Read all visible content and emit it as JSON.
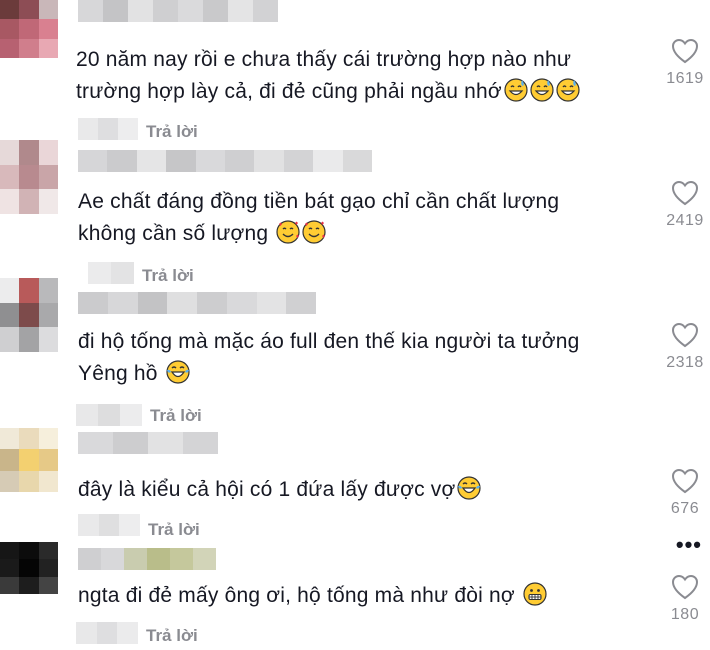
{
  "comments": [
    {
      "text_line1": "20 năm nay rồi e chưa thấy cái trường hợp nào như",
      "text_line2": "trường hợp lày cả, đi đẻ cũng phải ngầu nhớ",
      "emojis": [
        "grin-sweat-emoji",
        "grin-sweat-emoji",
        "grin-sweat-emoji"
      ],
      "reply_label": "Trả lời",
      "like_count": "1619"
    },
    {
      "text_line1": "Ae chất đáng đồng tiền bát gạo chỉ cần chất lượng",
      "text_line2": "không cần số lượng",
      "emojis": [
        "hearts-face-emoji",
        "hearts-face-emoji"
      ],
      "reply_label": "Trả lời",
      "like_count": "2419"
    },
    {
      "text_line1": "đi hộ tống mà mặc áo full đen thế kia người ta tưởng",
      "text_line2": "Yêng hồ",
      "emojis": [
        "tears-of-joy-emoji"
      ],
      "reply_label": "Trả lời",
      "like_count": "2318"
    },
    {
      "text_line1": "đây là kiểu cả hội có 1 đứa lấy được vợ",
      "emojis": [
        "tears-of-joy-emoji"
      ],
      "reply_label": "Trả lời",
      "like_count": "676"
    },
    {
      "text_line1": "ngta đi đẻ mấy ông ơi, hộ tống mà như đòi nợ",
      "emojis": [
        "grimacing-emoji"
      ],
      "reply_label": "Trả lời",
      "like_count": "180"
    }
  ],
  "more_menu": "•••",
  "colors": {
    "text": "#161823",
    "muted": "#8a8b91",
    "emoji_yellow": "#ffcc33"
  }
}
